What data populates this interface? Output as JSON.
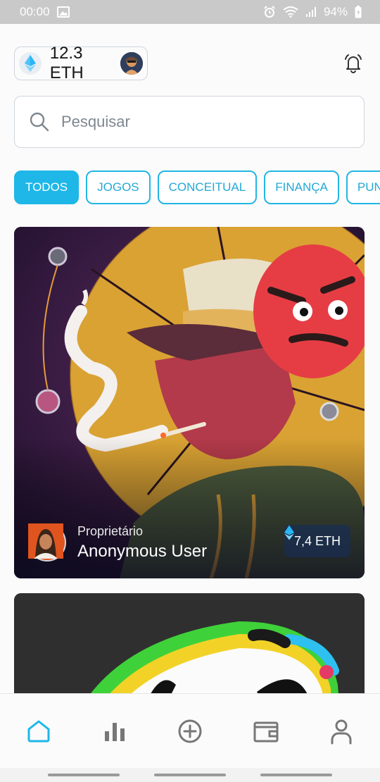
{
  "status_bar": {
    "time": "00:00",
    "battery": "94%"
  },
  "header": {
    "balance": "12.3 ETH"
  },
  "search": {
    "placeholder": "Pesquisar"
  },
  "categories": [
    {
      "label": "TODOS",
      "active": true
    },
    {
      "label": "JOGOS",
      "active": false
    },
    {
      "label": "CONCEITUAL",
      "active": false
    },
    {
      "label": "FINANÇA",
      "active": false
    },
    {
      "label": "PUNK",
      "active": false
    }
  ],
  "featured_card": {
    "owner_label": "Proprietário",
    "owner_name": "Anonymous User",
    "price": "7,4 ETH"
  },
  "bottom_nav": [
    "home-icon",
    "stats-icon",
    "add-icon",
    "wallet-icon",
    "profile-icon"
  ],
  "colors": {
    "accent": "#1eb7e8",
    "status_bar": "#c9c9c9"
  }
}
